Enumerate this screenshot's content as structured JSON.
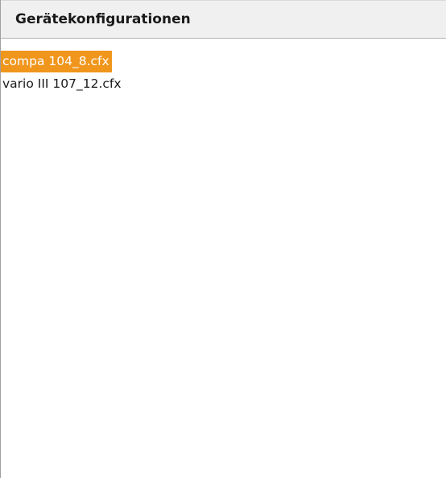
{
  "panel": {
    "header": "Gerätekonfigurationen",
    "selected_index": 0,
    "items": [
      {
        "label": "compa 104_8.cfx",
        "selected": true
      },
      {
        "label": "vario III 107_12.cfx",
        "selected": false
      }
    ]
  },
  "colors": {
    "selection": "#f0961c",
    "header_background": "#f0f0f0"
  }
}
